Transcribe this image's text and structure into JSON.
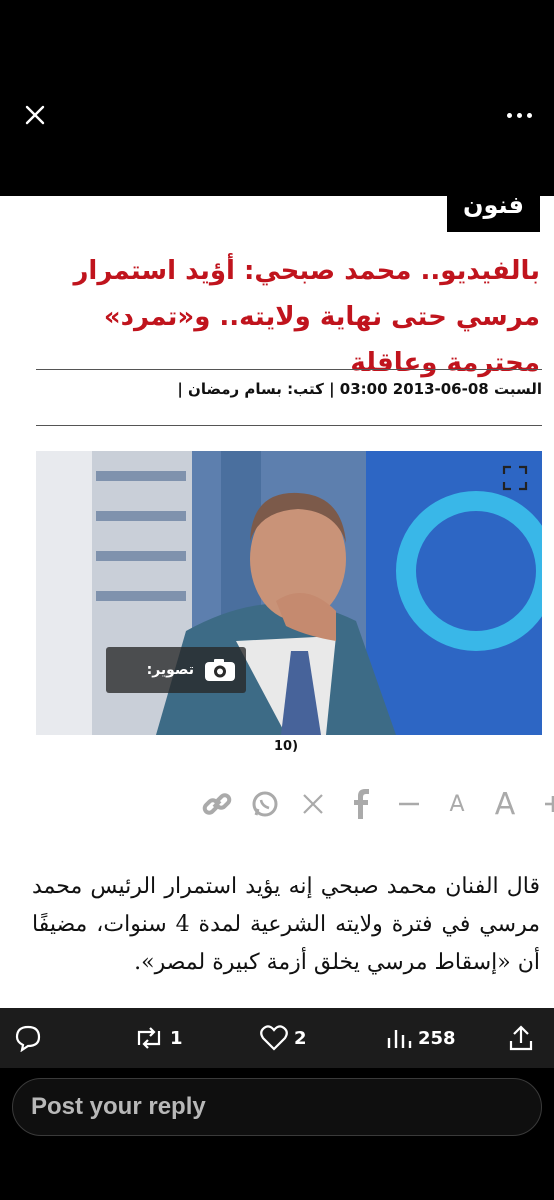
{
  "viewer": {
    "close_icon": "close-icon",
    "more_icon": "more-horizontal-icon"
  },
  "article": {
    "section_tag": "فنون",
    "headline": "بالفيديو.. محمد صبحي: أؤيد استمرار مرسي حتى نهاية ولايته.. و«تمرد» محترمة وعاقلة",
    "meta": "السبت 08-06-2013 03:00 | كتب: بسام رمضان |",
    "photo": {
      "caption_label": "تصوير:",
      "count": "(10"
    },
    "share_icons": [
      "link-icon",
      "whatsapp-icon",
      "x-icon",
      "facebook-icon",
      "minus-icon",
      "font-small-icon",
      "font-large-icon",
      "plus-icon"
    ],
    "font_small": "A",
    "font_large": "A",
    "body": "قال الفنان محمد صبحي إنه يؤيد استمرار الرئيس محمد مرسي في فترة ولايته الشرعية لمدة 4 سنوات، مضيفًا أن «إسقاط مرسي يخلق أزمة كبيرة لمصر»."
  },
  "engagement": {
    "retweets": "1",
    "likes": "2",
    "views": "258"
  },
  "reply": {
    "placeholder": "Post your reply"
  },
  "colors": {
    "headline": "#c0141d",
    "background": "#000000"
  }
}
